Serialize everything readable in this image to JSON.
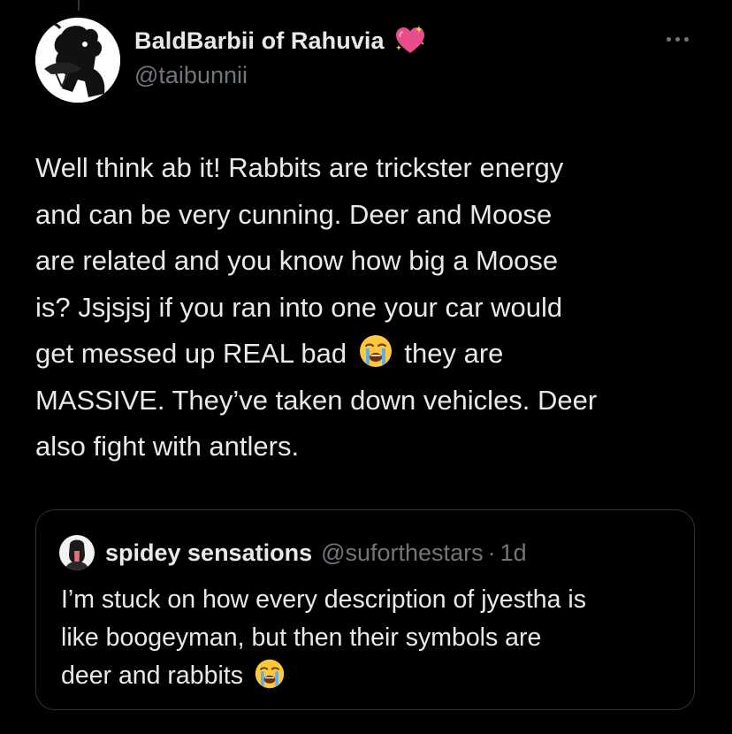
{
  "author": {
    "display_name": "BaldBarbii of Rahuvia",
    "name_emoji": "sparkling-heart-icon",
    "handle": "@taibunnii",
    "avatar": "avatar-image"
  },
  "tweet": {
    "lines": [
      "Well think ab it! Rabbits are trickster energy",
      "and can be very cunning. Deer and Moose",
      "are related and you know how big a Moose",
      "is? Jsjsjsj if you ran into one your car would",
      "get messed up REAL bad",
      "they are",
      "MASSIVE. They’ve taken down vehicles. Deer",
      "also fight with antlers."
    ],
    "emoji": "loudly-crying-face-icon"
  },
  "quote": {
    "display_name": "spidey sensations",
    "handle": "@suforthestars",
    "separator": "·",
    "time": "1d",
    "lines": [
      "I’m stuck on how every description of jyestha is",
      "like boogeyman, but then their symbols are",
      "deer and rabbits"
    ],
    "emoji": "loudly-crying-face-icon"
  },
  "colors": {
    "background": "#000000",
    "primary_text": "#e7e9ea",
    "secondary_text": "#71767b",
    "border": "#2f3336"
  }
}
